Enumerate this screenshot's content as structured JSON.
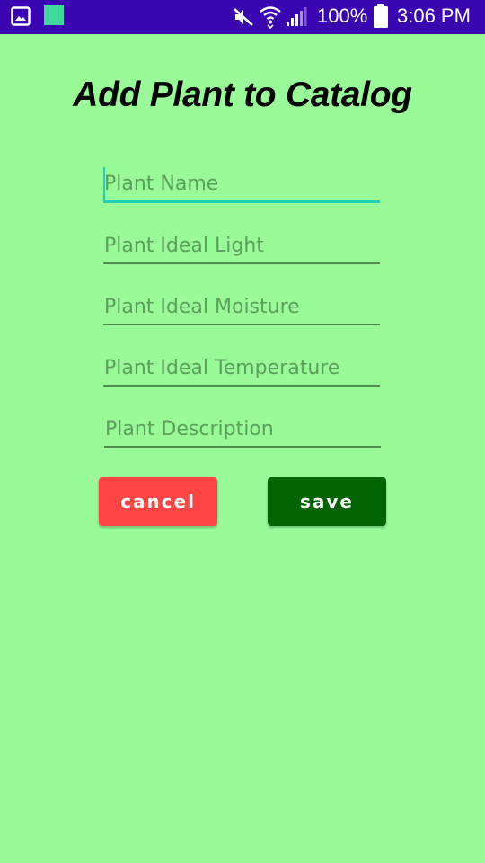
{
  "status_bar": {
    "battery": "100%",
    "time": "3:06 PM",
    "icons": [
      "gallery-icon",
      "app-notification-icon",
      "mute-icon",
      "wifi-icon",
      "signal-icon",
      "battery-icon"
    ],
    "background": "#3a04b0"
  },
  "page": {
    "title": "Add Plant to Catalog",
    "background": "#98FB98"
  },
  "form": {
    "fields": [
      {
        "name": "plant-name",
        "placeholder": "Plant Name",
        "value": "",
        "focused": true
      },
      {
        "name": "plant-ideal-light",
        "placeholder": "Plant Ideal Light",
        "value": ""
      },
      {
        "name": "plant-ideal-moisture",
        "placeholder": "Plant Ideal Moisture",
        "value": ""
      },
      {
        "name": "plant-ideal-temperature",
        "placeholder": "Plant Ideal Temperature",
        "value": ""
      },
      {
        "name": "plant-description",
        "placeholder": "Plant Description",
        "value": ""
      }
    ],
    "cancel_label": "cancel",
    "save_label": "save",
    "colors": {
      "accent": "#1fcfb8",
      "cancel": "#FF4444",
      "save": "#006400"
    }
  }
}
